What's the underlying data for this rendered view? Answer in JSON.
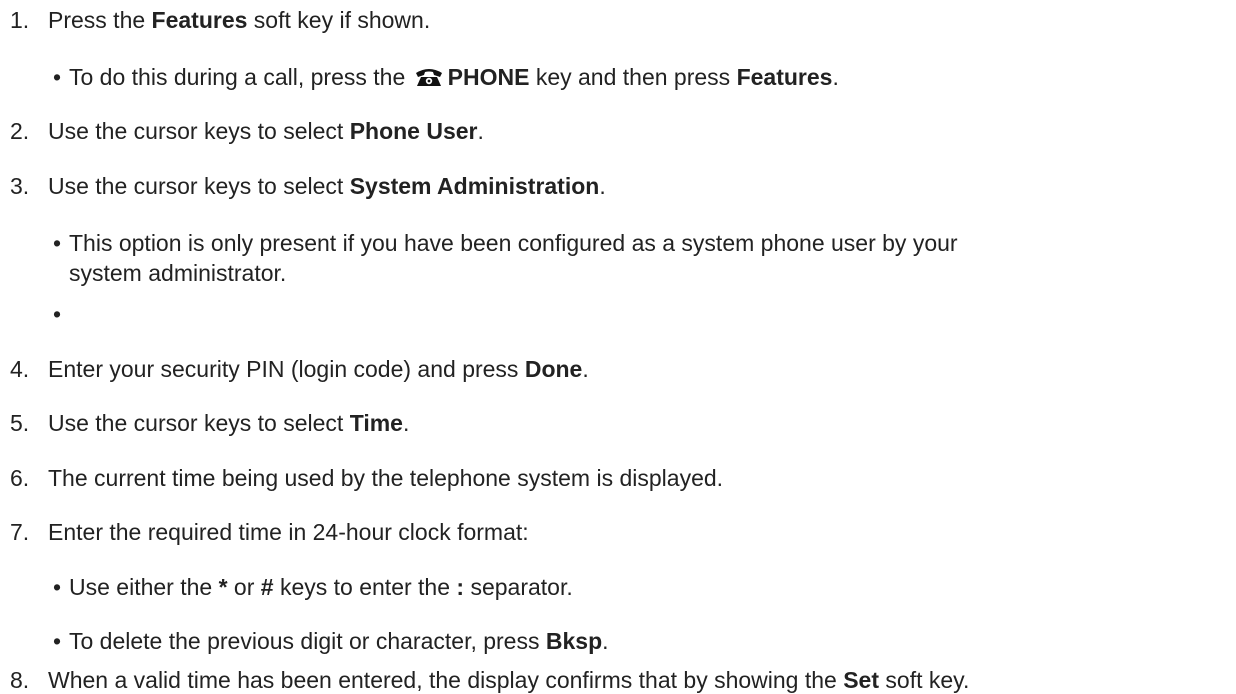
{
  "steps": [
    {
      "num": "1.",
      "a": "Press the ",
      "b": "Features",
      "c": " soft key if shown."
    },
    {
      "num": "2.",
      "a": "Use the cursor keys to select ",
      "b": "Phone User",
      "c": "."
    },
    {
      "num": "3.",
      "a": "Use the cursor keys to select ",
      "b": "System Administration",
      "c": "."
    },
    {
      "num": "4.",
      "a": "Enter your security PIN (login code) and press ",
      "b": "Done",
      "c": "."
    },
    {
      "num": "5.",
      "a": "Use the cursor keys to select ",
      "b": "Time",
      "c": "."
    },
    {
      "num": "6.",
      "a": "The current time being used by the telephone system is displayed."
    },
    {
      "num": "7.",
      "a": "Enter the required time in 24-hour clock format:"
    },
    {
      "num": "8.",
      "a": "When a valid time has been entered, the display confirms that by showing the ",
      "b": "Set",
      "c": " soft key."
    }
  ],
  "bullets": {
    "during_call": {
      "a": "To do this during a call, press the ",
      "icon": "phone-icon",
      "b": "PHONE",
      "c": " key and then press ",
      "d": "Features",
      "e": "."
    },
    "option_present": {
      "line1": "This option is only present if you have been configured as a system phone user by your",
      "line2": "system administrator."
    },
    "empty": {
      "mark": "•"
    },
    "separator": {
      "a": "Use either the ",
      "b": "*",
      "c": " or ",
      "d": "#",
      "e": " keys to enter the ",
      "f": ":",
      "g": " separator."
    },
    "delete": {
      "a": "To delete the previous digit or character, press ",
      "b": "Bksp",
      "c": "."
    },
    "mark": "•"
  }
}
